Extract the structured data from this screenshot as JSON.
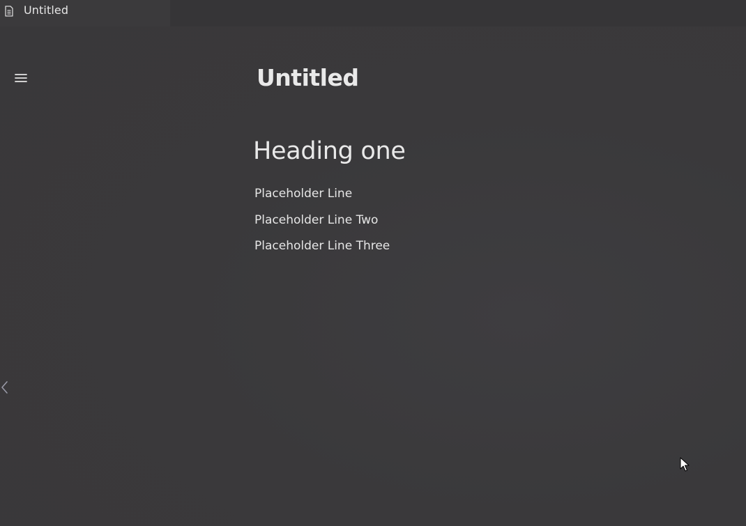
{
  "tab": {
    "title": "Untitled",
    "icon": "document-icon"
  },
  "toolbar": {
    "menu_icon": "hamburger-menu-icon",
    "collapse_icon": "chevron-left-icon"
  },
  "document": {
    "title": "Untitled",
    "heading": "Heading one",
    "lines": [
      "Placeholder Line",
      "Placeholder Line Two",
      "Placeholder Line Three"
    ]
  },
  "colors": {
    "background": "#3a393b",
    "text": "#e9e9e9",
    "muted_icon": "#9a9aa8"
  }
}
